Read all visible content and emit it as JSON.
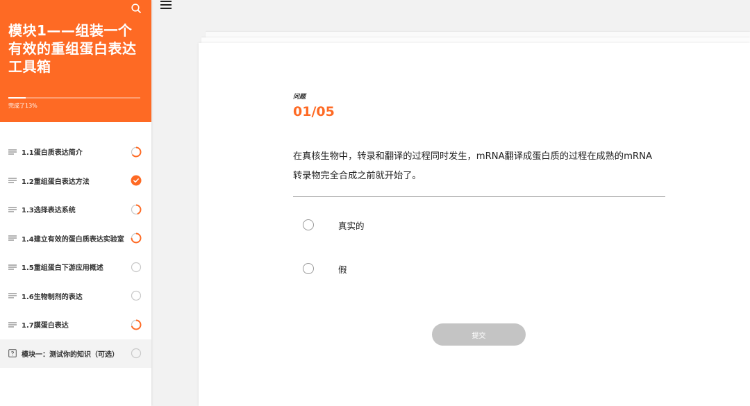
{
  "sidebar": {
    "course_title": "模块1——组装一个有效的重组蛋白表达工具箱",
    "progress_percent": 13,
    "progress_label": "完成了13%",
    "items": [
      {
        "label": "1.1蛋白质表达简介",
        "type": "lesson",
        "status": "in-progress",
        "progress": 0.65
      },
      {
        "label": "1.2重组蛋白表达方法",
        "type": "lesson",
        "status": "complete",
        "progress": 1.0
      },
      {
        "label": "1.3选择表达系统",
        "type": "lesson",
        "status": "in-progress",
        "progress": 0.45
      },
      {
        "label": "1.4建立有效的蛋白质表达实验室",
        "type": "lesson",
        "status": "in-progress",
        "progress": 0.75
      },
      {
        "label": "1.5重组蛋白下游应用概述",
        "type": "lesson",
        "status": "not-started",
        "progress": 0
      },
      {
        "label": "1.6生物制剂的表达",
        "type": "lesson",
        "status": "not-started",
        "progress": 0
      },
      {
        "label": "1.7膜蛋白表达",
        "type": "lesson",
        "status": "in-progress",
        "progress": 0.7
      },
      {
        "label": "模块一：测试你的知识（可选）",
        "type": "quiz",
        "status": "not-started",
        "progress": 0
      }
    ]
  },
  "quiz": {
    "label": "问题",
    "counter": "01/05",
    "question_line1": "在真核生物中，转录和翻译的过程同时发生，mRNA翻译成蛋白质的过程在成熟的mRNA",
    "question_line2": "转录物完全合成之前就开始了。",
    "options": [
      {
        "label": "真实的",
        "selected": false
      },
      {
        "label": "假",
        "selected": false
      }
    ],
    "submit_label": "提交"
  },
  "colors": {
    "accent": "#fe6a24",
    "submit_disabled": "#c4c4c4",
    "sidebar_text": "#333333"
  },
  "icons": {
    "search": "search-icon",
    "menu": "hamburger-menu-icon",
    "lesson": "lines-icon",
    "quiz": "question-box-icon",
    "complete": "check-icon"
  }
}
